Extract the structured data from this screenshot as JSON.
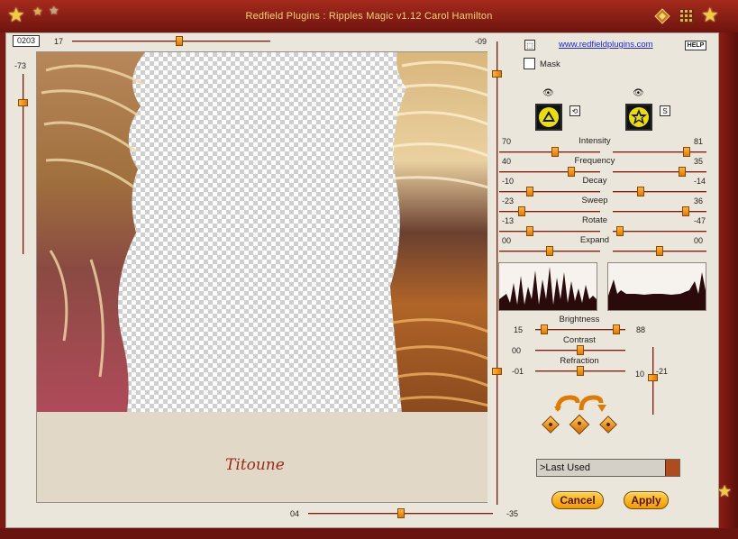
{
  "window": {
    "title": "Redfield Plugins : Ripples Magic v1.12   Carol Hamilton"
  },
  "top_controls": {
    "frame_counter": "0203",
    "h_slider_value": "17",
    "h_slider_fraction": 0.54,
    "right_value": "-09",
    "left_v_value": "-73",
    "left_v_fraction": 0.16
  },
  "right_vertical_slider": {
    "fraction": 0.09
  },
  "link": {
    "url_text": "www.redfieldplugins.com",
    "help_label": "HELP"
  },
  "mask": {
    "label": "Mask",
    "checked": false
  },
  "sliders": [
    {
      "label": "Intensity",
      "left": "70",
      "right": "81",
      "left_fraction": 0.55,
      "right_fraction": 0.79
    },
    {
      "label": "Frequency",
      "left": "40",
      "right": "35",
      "left_fraction": 0.71,
      "right_fraction": 0.74
    },
    {
      "label": "Decay",
      "left": "-10",
      "right": "-14",
      "left_fraction": 0.3,
      "right_fraction": 0.3
    },
    {
      "label": "Sweep",
      "left": "-23",
      "right": "36",
      "left_fraction": 0.22,
      "right_fraction": 0.78
    },
    {
      "label": "Rotate",
      "left": "-13",
      "right": "-47",
      "left_fraction": 0.3,
      "right_fraction": 0.08
    },
    {
      "label": "Expand",
      "left": "00",
      "right": "00",
      "left_fraction": 0.5,
      "right_fraction": 0.5
    }
  ],
  "light": [
    {
      "label": "Brightness",
      "left": "15",
      "right": "88",
      "left_fraction": 0.1,
      "right_fraction": 0.9
    },
    {
      "label": "Contrast",
      "left": "00",
      "right": "",
      "left_fraction": 0.5,
      "right_fraction": null
    },
    {
      "label": "Refraction",
      "left": "-01",
      "right": "10",
      "left_fraction": 0.5,
      "right_fraction": null
    }
  ],
  "light_vertical": {
    "value": "-21",
    "fraction": 0.45
  },
  "preview_right_slider": {
    "fraction": 0.22
  },
  "bottom": {
    "slider_value": "04",
    "slider_fraction": 0.5,
    "right_value": "-35"
  },
  "signature": "Titoune",
  "presets": {
    "value": ">Last Used"
  },
  "buttons": {
    "cancel": "Cancel",
    "apply": "Apply"
  },
  "colors": {
    "frame": "#7a1a14",
    "panel": "#ebe6dc",
    "accent": "#f39a00",
    "title_text": "#f4d27a"
  },
  "icons": {
    "thumb1": "triangle-ring-icon",
    "thumb2": "star-ring-icon",
    "eye": "eye-icon"
  }
}
